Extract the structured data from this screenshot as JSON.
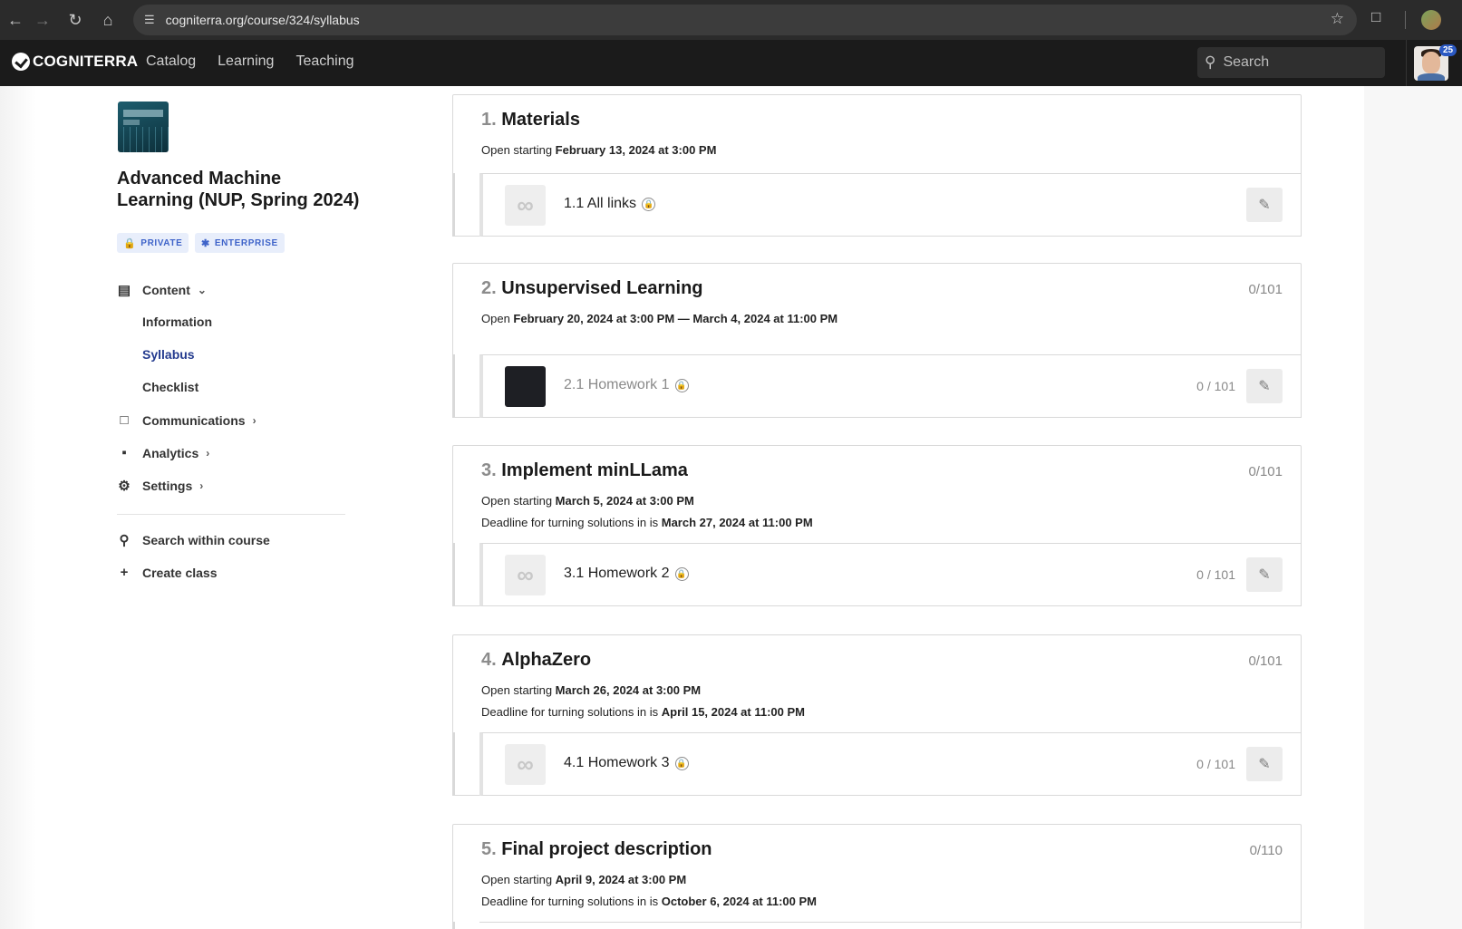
{
  "browser": {
    "url": "cogniterra.org/course/324/syllabus"
  },
  "header": {
    "logo": "COGNITERRA",
    "nav": [
      "Catalog",
      "Learning",
      "Teaching"
    ],
    "search_placeholder": "Search",
    "notification_count": "25"
  },
  "course": {
    "title": "Advanced Machine Learning (NUP, Spring 2024)",
    "badges": [
      "PRIVATE",
      "ENTERPRISE"
    ]
  },
  "sidebar": {
    "content": "Content",
    "sub_items": [
      "Information",
      "Syllabus",
      "Checklist"
    ],
    "active_sub": "Syllabus",
    "communications": "Communications",
    "analytics": "Analytics",
    "settings": "Settings",
    "search_course": "Search within course",
    "create_class": "Create class"
  },
  "sections": [
    {
      "num": "1.",
      "title": "Materials",
      "score": "",
      "line1_prefix": "Open starting ",
      "line1_value": "February 13, 2024 at 3:00 PM",
      "line2_prefix": "",
      "line2_value": "",
      "item": {
        "name": "1.1 All links",
        "score": "",
        "icon": "link-icon",
        "muted": false
      }
    },
    {
      "num": "2.",
      "title": "Unsupervised Learning",
      "score": "0/101",
      "line1_prefix": "Open ",
      "line1_value": "February 20, 2024 at 3:00 PM — March 4, 2024 at 11:00 PM",
      "line2_prefix": "",
      "line2_value": "",
      "item": {
        "name": "2.1 Homework 1",
        "score": "0 / 101",
        "icon": "dark-thumbnail",
        "muted": true
      }
    },
    {
      "num": "3.",
      "title": "Implement minLLama",
      "score": "0/101",
      "line1_prefix": "Open starting ",
      "line1_value": "March 5, 2024 at 3:00 PM",
      "line2_prefix": "Deadline for turning solutions in is ",
      "line2_value": "March 27, 2024 at 11:00 PM",
      "item": {
        "name": "3.1 Homework 2",
        "score": "0 / 101",
        "icon": "link-icon",
        "muted": false
      }
    },
    {
      "num": "4.",
      "title": "AlphaZero",
      "score": "0/101",
      "line1_prefix": "Open starting ",
      "line1_value": "March 26, 2024 at 3:00 PM",
      "line2_prefix": "Deadline for turning solutions in is ",
      "line2_value": "April 15, 2024 at 11:00 PM",
      "item": {
        "name": "4.1 Homework 3",
        "score": "0 / 101",
        "icon": "link-icon",
        "muted": false
      }
    },
    {
      "num": "5.",
      "title": "Final project description",
      "score": "0/110",
      "line1_prefix": "Open starting ",
      "line1_value": "April 9, 2024 at 3:00 PM",
      "line2_prefix": "Deadline for turning solutions in is ",
      "line2_value": "October 6, 2024 at 11:00 PM"
    }
  ]
}
